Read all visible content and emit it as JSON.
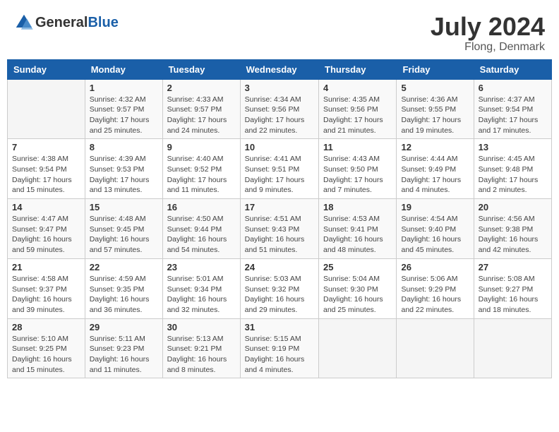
{
  "header": {
    "logo_general": "General",
    "logo_blue": "Blue",
    "title": "July 2024",
    "location": "Flong, Denmark"
  },
  "days_of_week": [
    "Sunday",
    "Monday",
    "Tuesday",
    "Wednesday",
    "Thursday",
    "Friday",
    "Saturday"
  ],
  "weeks": [
    [
      {
        "day": "",
        "info": ""
      },
      {
        "day": "1",
        "info": "Sunrise: 4:32 AM\nSunset: 9:57 PM\nDaylight: 17 hours and 25 minutes."
      },
      {
        "day": "2",
        "info": "Sunrise: 4:33 AM\nSunset: 9:57 PM\nDaylight: 17 hours and 24 minutes."
      },
      {
        "day": "3",
        "info": "Sunrise: 4:34 AM\nSunset: 9:56 PM\nDaylight: 17 hours and 22 minutes."
      },
      {
        "day": "4",
        "info": "Sunrise: 4:35 AM\nSunset: 9:56 PM\nDaylight: 17 hours and 21 minutes."
      },
      {
        "day": "5",
        "info": "Sunrise: 4:36 AM\nSunset: 9:55 PM\nDaylight: 17 hours and 19 minutes."
      },
      {
        "day": "6",
        "info": "Sunrise: 4:37 AM\nSunset: 9:54 PM\nDaylight: 17 hours and 17 minutes."
      }
    ],
    [
      {
        "day": "7",
        "info": "Sunrise: 4:38 AM\nSunset: 9:54 PM\nDaylight: 17 hours and 15 minutes."
      },
      {
        "day": "8",
        "info": "Sunrise: 4:39 AM\nSunset: 9:53 PM\nDaylight: 17 hours and 13 minutes."
      },
      {
        "day": "9",
        "info": "Sunrise: 4:40 AM\nSunset: 9:52 PM\nDaylight: 17 hours and 11 minutes."
      },
      {
        "day": "10",
        "info": "Sunrise: 4:41 AM\nSunset: 9:51 PM\nDaylight: 17 hours and 9 minutes."
      },
      {
        "day": "11",
        "info": "Sunrise: 4:43 AM\nSunset: 9:50 PM\nDaylight: 17 hours and 7 minutes."
      },
      {
        "day": "12",
        "info": "Sunrise: 4:44 AM\nSunset: 9:49 PM\nDaylight: 17 hours and 4 minutes."
      },
      {
        "day": "13",
        "info": "Sunrise: 4:45 AM\nSunset: 9:48 PM\nDaylight: 17 hours and 2 minutes."
      }
    ],
    [
      {
        "day": "14",
        "info": "Sunrise: 4:47 AM\nSunset: 9:47 PM\nDaylight: 16 hours and 59 minutes."
      },
      {
        "day": "15",
        "info": "Sunrise: 4:48 AM\nSunset: 9:45 PM\nDaylight: 16 hours and 57 minutes."
      },
      {
        "day": "16",
        "info": "Sunrise: 4:50 AM\nSunset: 9:44 PM\nDaylight: 16 hours and 54 minutes."
      },
      {
        "day": "17",
        "info": "Sunrise: 4:51 AM\nSunset: 9:43 PM\nDaylight: 16 hours and 51 minutes."
      },
      {
        "day": "18",
        "info": "Sunrise: 4:53 AM\nSunset: 9:41 PM\nDaylight: 16 hours and 48 minutes."
      },
      {
        "day": "19",
        "info": "Sunrise: 4:54 AM\nSunset: 9:40 PM\nDaylight: 16 hours and 45 minutes."
      },
      {
        "day": "20",
        "info": "Sunrise: 4:56 AM\nSunset: 9:38 PM\nDaylight: 16 hours and 42 minutes."
      }
    ],
    [
      {
        "day": "21",
        "info": "Sunrise: 4:58 AM\nSunset: 9:37 PM\nDaylight: 16 hours and 39 minutes."
      },
      {
        "day": "22",
        "info": "Sunrise: 4:59 AM\nSunset: 9:35 PM\nDaylight: 16 hours and 36 minutes."
      },
      {
        "day": "23",
        "info": "Sunrise: 5:01 AM\nSunset: 9:34 PM\nDaylight: 16 hours and 32 minutes."
      },
      {
        "day": "24",
        "info": "Sunrise: 5:03 AM\nSunset: 9:32 PM\nDaylight: 16 hours and 29 minutes."
      },
      {
        "day": "25",
        "info": "Sunrise: 5:04 AM\nSunset: 9:30 PM\nDaylight: 16 hours and 25 minutes."
      },
      {
        "day": "26",
        "info": "Sunrise: 5:06 AM\nSunset: 9:29 PM\nDaylight: 16 hours and 22 minutes."
      },
      {
        "day": "27",
        "info": "Sunrise: 5:08 AM\nSunset: 9:27 PM\nDaylight: 16 hours and 18 minutes."
      }
    ],
    [
      {
        "day": "28",
        "info": "Sunrise: 5:10 AM\nSunset: 9:25 PM\nDaylight: 16 hours and 15 minutes."
      },
      {
        "day": "29",
        "info": "Sunrise: 5:11 AM\nSunset: 9:23 PM\nDaylight: 16 hours and 11 minutes."
      },
      {
        "day": "30",
        "info": "Sunrise: 5:13 AM\nSunset: 9:21 PM\nDaylight: 16 hours and 8 minutes."
      },
      {
        "day": "31",
        "info": "Sunrise: 5:15 AM\nSunset: 9:19 PM\nDaylight: 16 hours and 4 minutes."
      },
      {
        "day": "",
        "info": ""
      },
      {
        "day": "",
        "info": ""
      },
      {
        "day": "",
        "info": ""
      }
    ]
  ]
}
